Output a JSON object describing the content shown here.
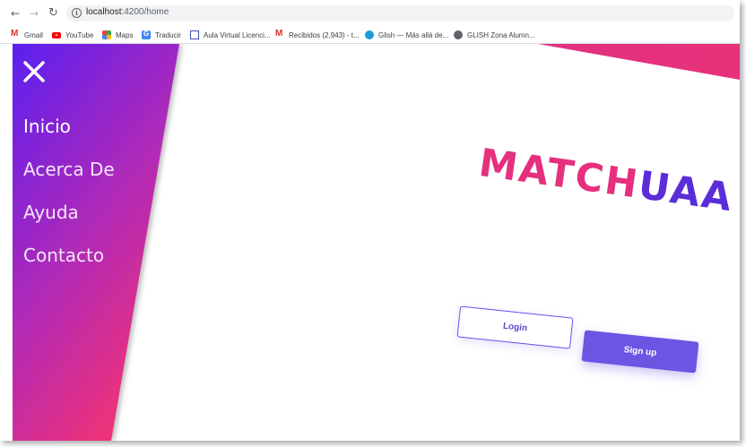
{
  "browser": {
    "url_host": "localhost",
    "url_path": ":4200/home",
    "bookmarks": [
      {
        "label": "Gmail",
        "icon": "gmail-icon"
      },
      {
        "label": "YouTube",
        "icon": "youtube-icon"
      },
      {
        "label": "Maps",
        "icon": "maps-icon"
      },
      {
        "label": "Traducir",
        "icon": "translate-icon"
      },
      {
        "label": "Aula Virtual Licenci...",
        "icon": "aula-icon"
      },
      {
        "label": "Recibidos (2,943) - t...",
        "icon": "gmail-icon"
      },
      {
        "label": "Glish — Más allá de...",
        "icon": "glish-icon"
      },
      {
        "label": "GLISH Zona Alumn...",
        "icon": "globe-icon"
      }
    ]
  },
  "sidebar": {
    "close_icon": "close-icon",
    "items": [
      {
        "label": "Inicio"
      },
      {
        "label": "Acerca De"
      },
      {
        "label": "Ayuda"
      },
      {
        "label": "Contacto"
      }
    ]
  },
  "logo": {
    "part1": "MATCH",
    "part2": "UAA"
  },
  "actions": {
    "login_label": "Login",
    "signup_label": "Sign up"
  },
  "colors": {
    "sidebar_top": "#5b1ff0",
    "sidebar_bottom": "#e8317a",
    "logo_pink": "#e5307e",
    "logo_purple": "#5b2dd9",
    "button_primary": "#6b55e3"
  }
}
